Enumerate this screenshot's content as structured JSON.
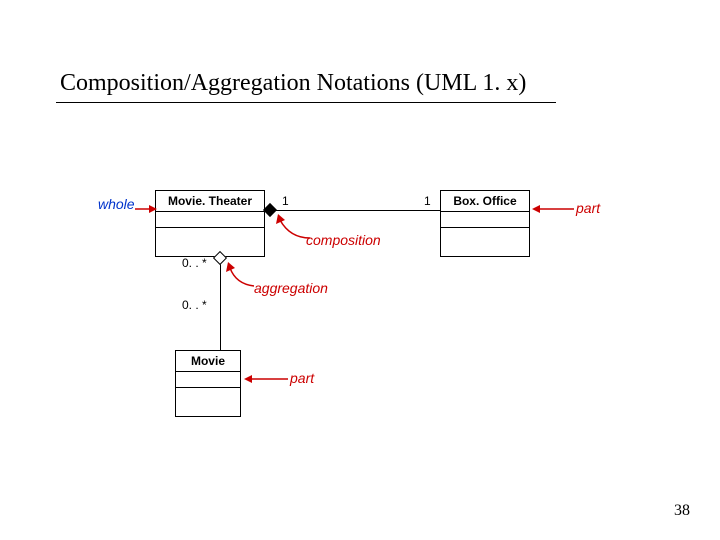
{
  "title": "Composition/Aggregation Notations (UML 1. x)",
  "classes": {
    "movietheater": "Movie. Theater",
    "boxoffice": "Box. Office",
    "movie": "Movie"
  },
  "multiplicities": {
    "comp_left": "1",
    "comp_right": "1",
    "agg_top": "0. . *",
    "agg_bottom": "0. . *"
  },
  "annotations": {
    "whole": "whole",
    "part1": "part",
    "part2": "part",
    "composition": "composition",
    "aggregation": "aggregation"
  },
  "page_number": "38"
}
